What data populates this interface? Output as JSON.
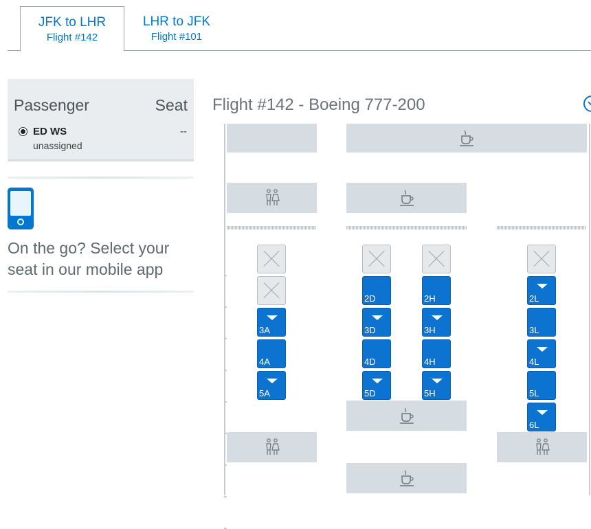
{
  "tabs": [
    {
      "route": "JFK to LHR",
      "flight": "Flight #142",
      "active": true
    },
    {
      "route": "LHR to JFK",
      "flight": "Flight #101",
      "active": false
    }
  ],
  "passenger_panel": {
    "header_passenger": "Passenger",
    "header_seat": "Seat",
    "passenger": {
      "name": "ED WS",
      "status": "unassigned",
      "seat": "--",
      "selected": true
    }
  },
  "promo": {
    "text": "On the go? Select your seat in our mobile app",
    "icon": "mobile-phone-icon"
  },
  "seatmap": {
    "title": "Flight #142 - Boeing 777-200",
    "available_color": "#0c74d0",
    "blocked_color": "#e6e9eb",
    "icons": {
      "galley": "coffee-cup-icon",
      "lavatory": "restroom-icon"
    },
    "seats": [
      {
        "row": 1,
        "col": "A",
        "label": "",
        "status": "unavailable"
      },
      {
        "row": 2,
        "col": "A",
        "label": "",
        "status": "unavailable"
      },
      {
        "row": 3,
        "col": "A",
        "label": "3A",
        "status": "available",
        "preferred": true
      },
      {
        "row": 4,
        "col": "A",
        "label": "4A",
        "status": "available",
        "preferred": false
      },
      {
        "row": 5,
        "col": "A",
        "label": "5A",
        "status": "available",
        "preferred": true
      },
      {
        "row": 1,
        "col": "D",
        "label": "",
        "status": "unavailable"
      },
      {
        "row": 2,
        "col": "D",
        "label": "2D",
        "status": "available",
        "preferred": false
      },
      {
        "row": 3,
        "col": "D",
        "label": "3D",
        "status": "available",
        "preferred": true
      },
      {
        "row": 4,
        "col": "D",
        "label": "4D",
        "status": "available",
        "preferred": false
      },
      {
        "row": 5,
        "col": "D",
        "label": "5D",
        "status": "available",
        "preferred": true
      },
      {
        "row": 1,
        "col": "H",
        "label": "",
        "status": "unavailable"
      },
      {
        "row": 2,
        "col": "H",
        "label": "2H",
        "status": "available",
        "preferred": false
      },
      {
        "row": 3,
        "col": "H",
        "label": "3H",
        "status": "available",
        "preferred": true
      },
      {
        "row": 4,
        "col": "H",
        "label": "4H",
        "status": "available",
        "preferred": false
      },
      {
        "row": 5,
        "col": "H",
        "label": "5H",
        "status": "available",
        "preferred": true
      },
      {
        "row": 1,
        "col": "L",
        "label": "",
        "status": "unavailable"
      },
      {
        "row": 2,
        "col": "L",
        "label": "2L",
        "status": "available",
        "preferred": true
      },
      {
        "row": 3,
        "col": "L",
        "label": "3L",
        "status": "available",
        "preferred": false
      },
      {
        "row": 4,
        "col": "L",
        "label": "4L",
        "status": "available",
        "preferred": true
      },
      {
        "row": 5,
        "col": "L",
        "label": "5L",
        "status": "available",
        "preferred": false
      },
      {
        "row": 6,
        "col": "L",
        "label": "6L",
        "status": "available",
        "preferred": true
      }
    ]
  }
}
